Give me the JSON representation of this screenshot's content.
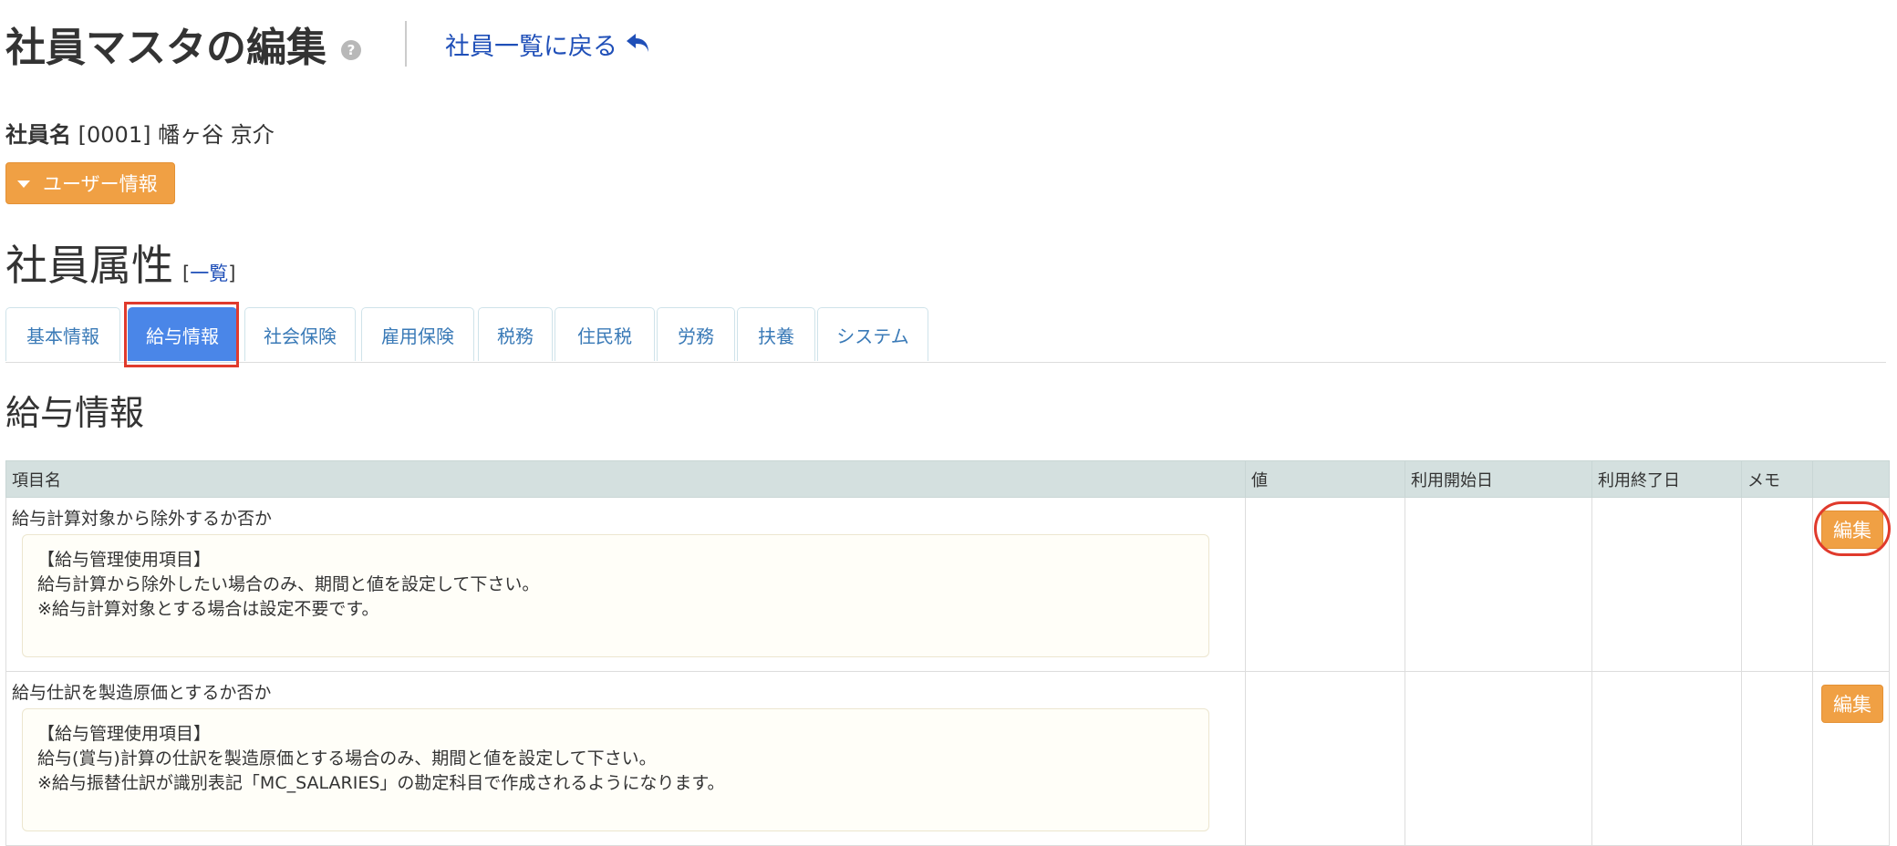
{
  "header": {
    "title": "社員マスタの編集",
    "help_icon": "?",
    "back_link": "社員一覧に戻る",
    "back_icon_name": "reply-arrow-icon"
  },
  "employee": {
    "label": "社員名",
    "value": "[0001] 幡ヶ谷 京介"
  },
  "user_info_button": "ユーザー情報",
  "attributes": {
    "title": "社員属性",
    "list_prefix": "[",
    "list_link": "一覧",
    "list_suffix": "]"
  },
  "tabs": [
    {
      "label": "基本情報"
    },
    {
      "label": "給与情報"
    },
    {
      "label": "社会保険"
    },
    {
      "label": "雇用保険"
    },
    {
      "label": "税務"
    },
    {
      "label": "住民税"
    },
    {
      "label": "労務"
    },
    {
      "label": "扶養"
    },
    {
      "label": "システム"
    }
  ],
  "active_tab": "給与情報",
  "section_title": "給与情報",
  "table": {
    "headers": [
      "項目名",
      "値",
      "利用開始日",
      "利用終了日",
      "メモ",
      ""
    ],
    "rows": [
      {
        "name": "給与計算対象から除外するか否か",
        "note": [
          "【給与管理使用項目】",
          "給与計算から除外したい場合のみ、期間と値を設定して下さい。",
          "※給与計算対象とする場合は設定不要です。"
        ],
        "edit_label": "編集"
      },
      {
        "name": "給与仕訳を製造原価とするか否か",
        "note": [
          "【給与管理使用項目】",
          "給与(賞与)計算の仕訳を製造原価とする場合のみ、期間と値を設定して下さい。",
          "※給与振替仕訳が識別表記「MC_SALARIES」の勘定科目で作成されるようになります。"
        ],
        "edit_label": "編集"
      }
    ]
  },
  "colors": {
    "accent_orange": "#f0a044",
    "tab_active": "#4a86e8",
    "link_blue": "#1f4fb8",
    "header_bg": "#d4e0df",
    "highlight_red": "#e03a2c"
  }
}
